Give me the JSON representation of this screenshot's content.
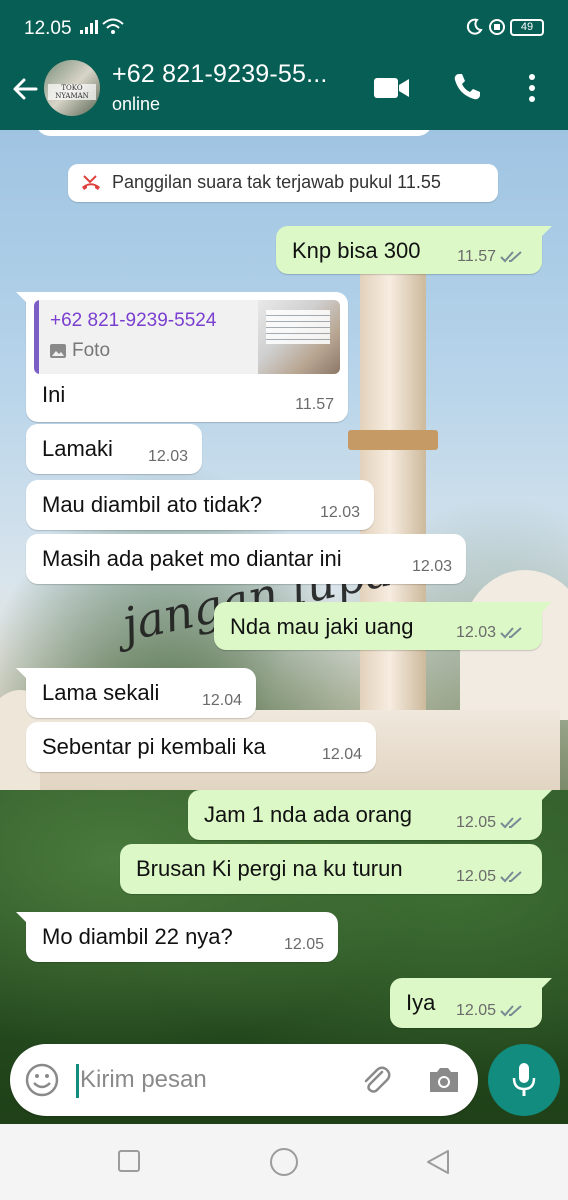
{
  "status_bar": {
    "time": "12.05",
    "battery": "49"
  },
  "header": {
    "contact_name": "+62 821-9239-55...",
    "status": "online",
    "avatar_text": "TOKO NYAMAN"
  },
  "system_message": {
    "text": "Panggilan suara tak terjawab pukul 11.55"
  },
  "background_script_text": "jangan lupa",
  "messages": [
    {
      "direction": "out",
      "text": "Knp bisa 300",
      "time": "11.57",
      "read": true
    },
    {
      "direction": "in",
      "quote": {
        "name": "+62 821-9239-5524",
        "label": "Foto"
      },
      "text": "Ini",
      "time": "11.57"
    },
    {
      "direction": "in",
      "text": "Lamaki",
      "time": "12.03"
    },
    {
      "direction": "in",
      "text": "Mau diambil ato tidak?",
      "time": "12.03"
    },
    {
      "direction": "in",
      "text": "Masih ada paket mo diantar ini",
      "time": "12.03"
    },
    {
      "direction": "out",
      "text": "Nda mau jaki uang",
      "time": "12.03",
      "read": true
    },
    {
      "direction": "in",
      "text": "Lama sekali",
      "time": "12.04"
    },
    {
      "direction": "in",
      "text": "Sebentar pi kembali ka",
      "time": "12.04"
    },
    {
      "direction": "out",
      "text": "Jam 1 nda ada orang",
      "time": "12.05",
      "read": true
    },
    {
      "direction": "out",
      "text": "Brusan Ki pergi na ku turun",
      "time": "12.05",
      "read": true
    },
    {
      "direction": "in",
      "text": "Mo diambil 22 nya?",
      "time": "12.05"
    },
    {
      "direction": "out",
      "text": "Iya",
      "time": "12.05",
      "read": true
    }
  ],
  "input": {
    "placeholder": "Kirim pesan"
  },
  "colors": {
    "header": "#075e54",
    "outgoing_bubble": "#dcf8c6",
    "incoming_bubble": "#ffffff",
    "accent": "#128c7e",
    "read_ticks": "#7a8a94"
  },
  "icons": [
    "back-arrow-icon",
    "video-call-icon",
    "phone-icon",
    "more-vert-icon",
    "missed-call-icon",
    "photo-icon",
    "double-check-icon",
    "emoji-icon",
    "attach-icon",
    "camera-icon",
    "mic-icon"
  ]
}
